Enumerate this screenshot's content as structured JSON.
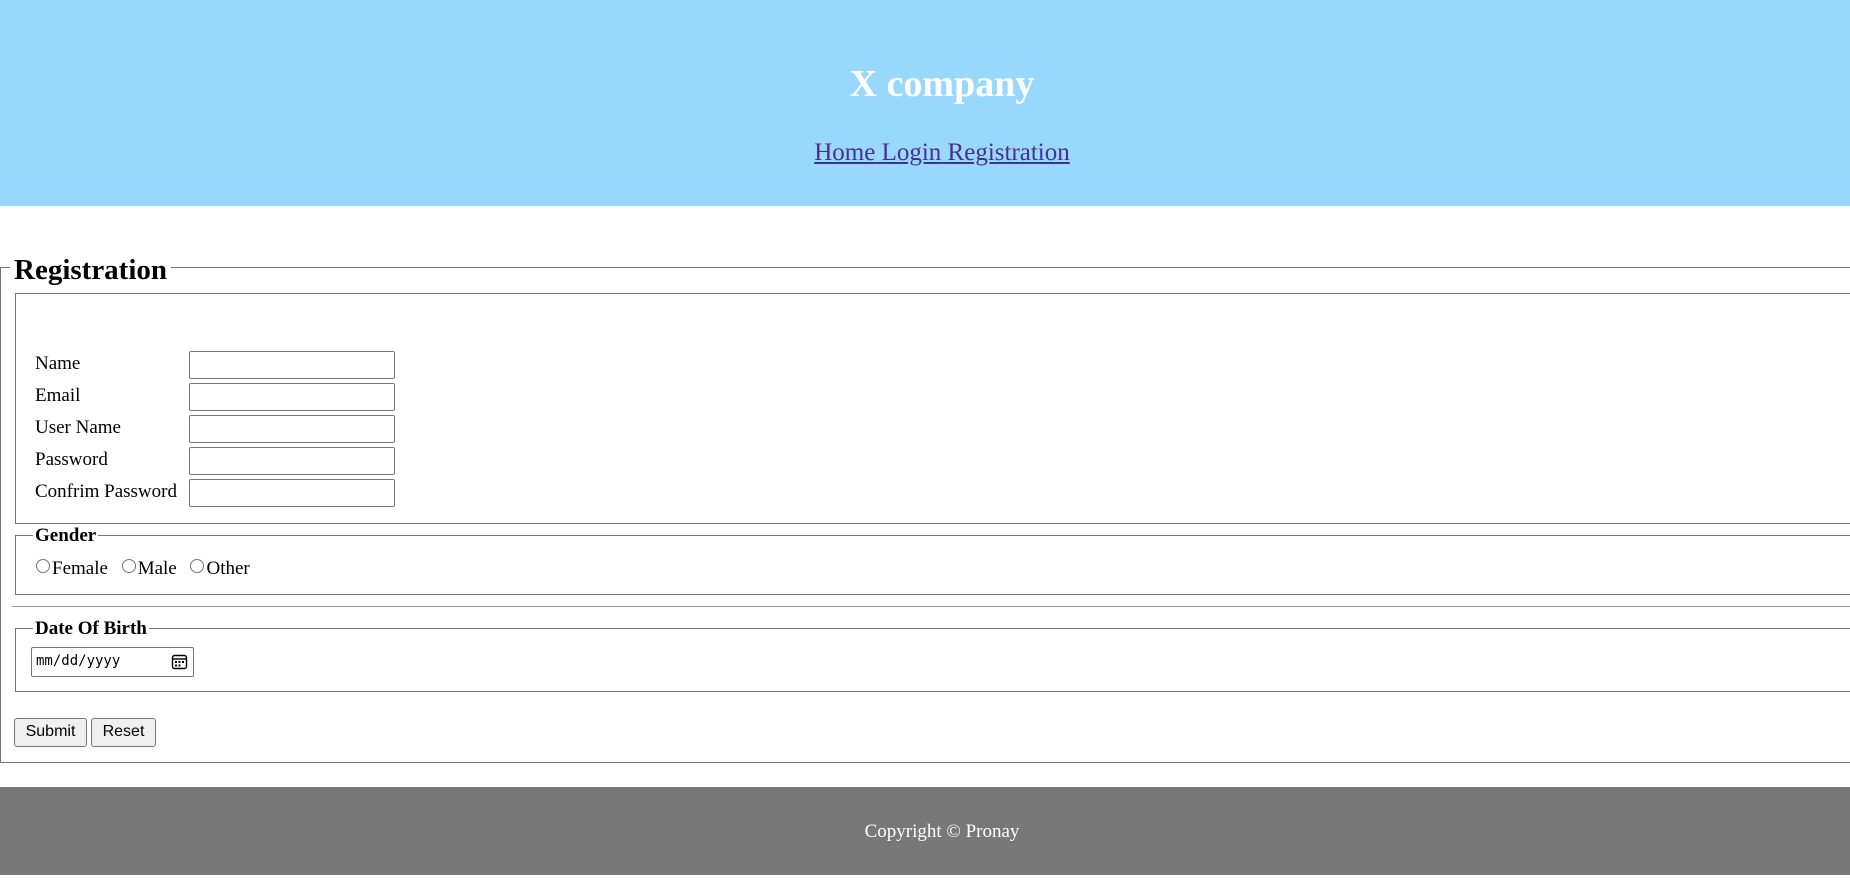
{
  "header": {
    "title": "X company",
    "nav": [
      "Home",
      "Login",
      "Registration"
    ]
  },
  "form": {
    "legend": "Registration",
    "fields": [
      {
        "label": "Name",
        "value": ""
      },
      {
        "label": "Email",
        "value": ""
      },
      {
        "label": "User Name",
        "value": ""
      },
      {
        "label": "Password",
        "value": ""
      },
      {
        "label": "Confrim Password",
        "value": ""
      }
    ],
    "gender": {
      "legend": "Gender",
      "options": [
        "Female",
        "Male",
        "Other"
      ]
    },
    "dob": {
      "legend": "Date Of Birth",
      "placeholder": "mm/dd/yyyy",
      "icon": "calendar-icon"
    },
    "buttons": {
      "submit": "Submit",
      "reset": "Reset"
    }
  },
  "footer": {
    "copyright": "Copyright © Pronay"
  },
  "colors": {
    "header_bg": "#99d8fd",
    "footer_bg": "#787878",
    "link": "#4b2f8f"
  }
}
